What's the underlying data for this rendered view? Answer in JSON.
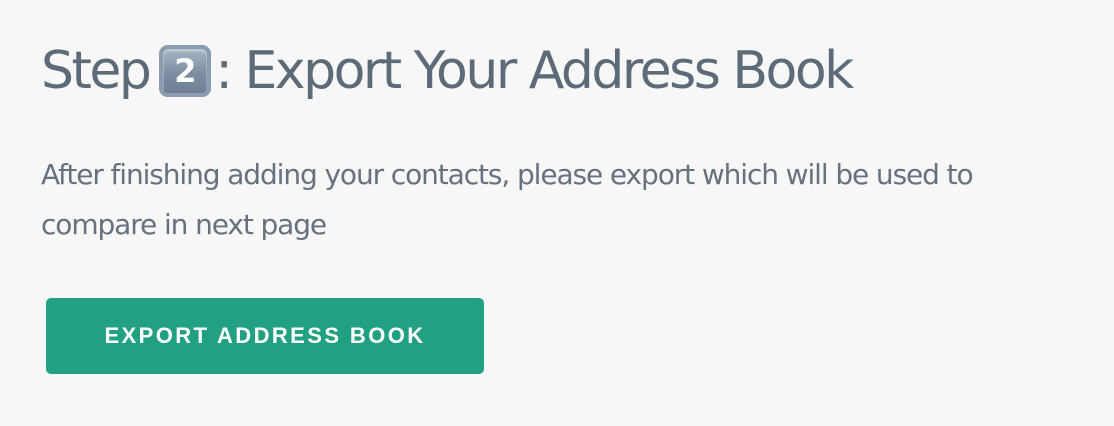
{
  "step": {
    "title_prefix": "Step",
    "step_number": "2",
    "title_suffix": ": Export Your Address Book",
    "description": "After finishing adding your contacts, please export which will be used to compare in next page",
    "button_label": "EXPORT ADDRESS BOOK"
  },
  "colors": {
    "title_text": "#5d6a78",
    "body_text": "#66727f",
    "button_bg": "#22a082",
    "button_text": "#ffffff",
    "page_bg": "#f7f7f7"
  },
  "icons": {
    "step_number": "keycap-digit-two-icon"
  }
}
